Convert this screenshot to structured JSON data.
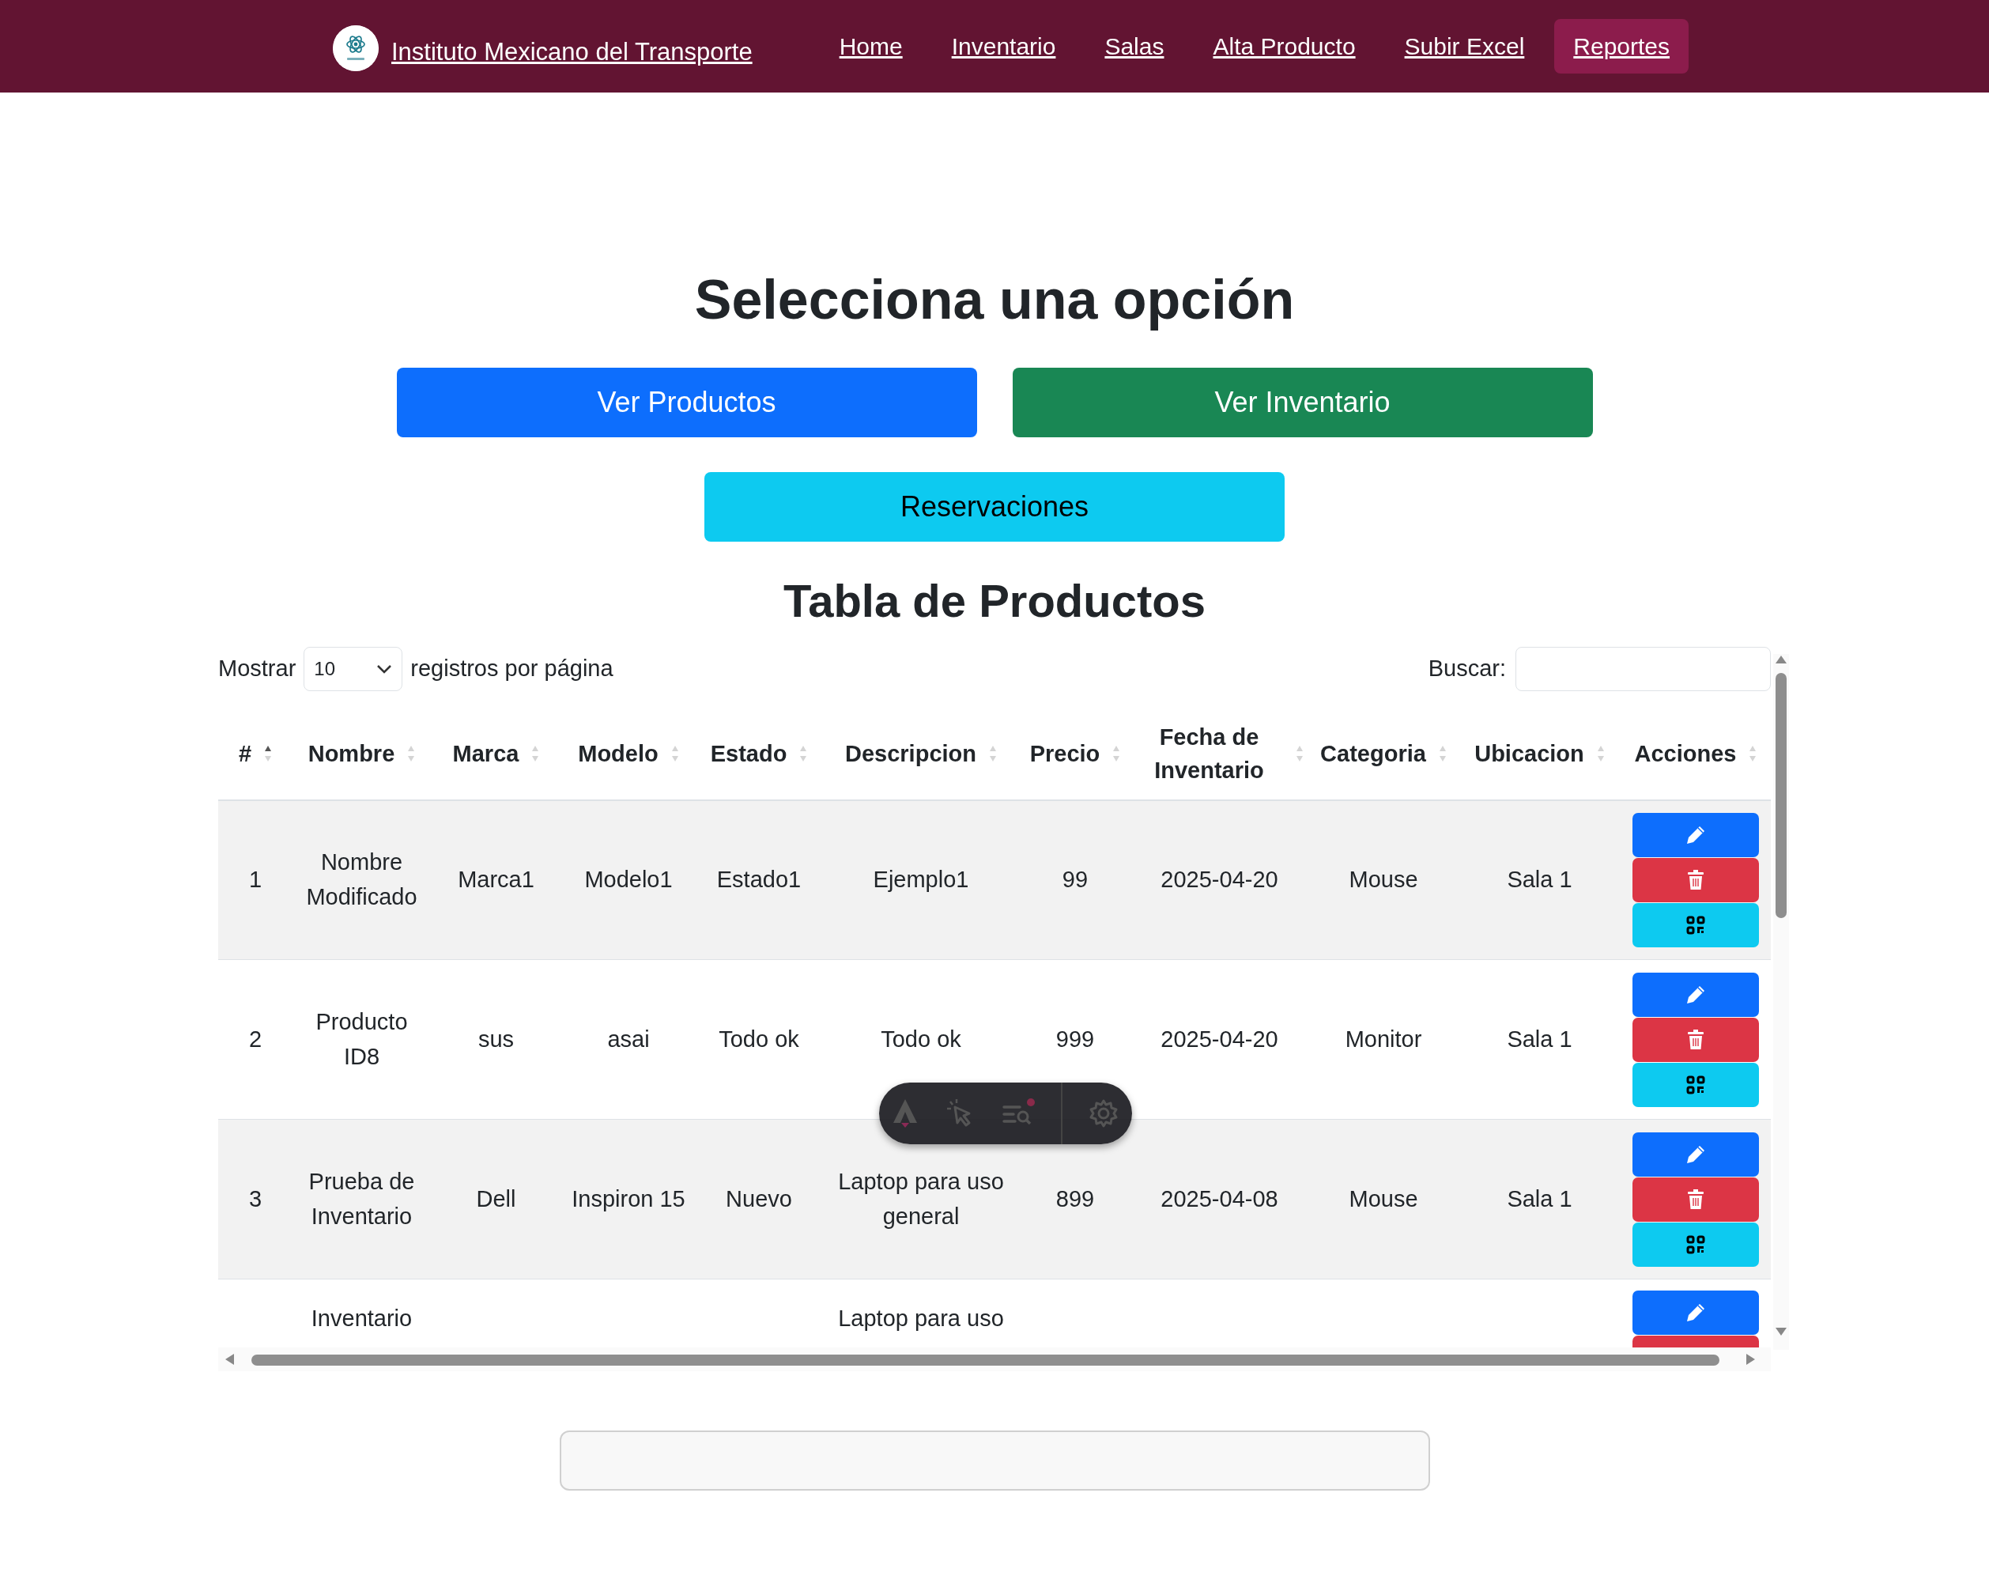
{
  "navbar": {
    "brand": "Instituto Mexicano del Transporte",
    "links": [
      {
        "label": "Home",
        "selected": false
      },
      {
        "label": "Inventario",
        "selected": false
      },
      {
        "label": "Salas",
        "selected": false
      },
      {
        "label": "Alta Producto",
        "selected": false
      },
      {
        "label": "Subir Excel",
        "selected": false
      },
      {
        "label": "Reportes",
        "selected": true
      }
    ]
  },
  "heading": "Selecciona una opción",
  "option_buttons": [
    {
      "label": "Ver Productos",
      "kind": "primary"
    },
    {
      "label": "Ver Inventario",
      "kind": "success"
    },
    {
      "label": "Reservaciones",
      "kind": "info"
    }
  ],
  "table_title": "Tabla de Productos",
  "length_control": {
    "prefix": "Mostrar",
    "value": "10",
    "suffix": "registros por página"
  },
  "search": {
    "label": "Buscar:"
  },
  "table": {
    "columns": [
      {
        "label": "#",
        "sorted": true
      },
      {
        "label": "Nombre",
        "sorted": false
      },
      {
        "label": "Marca",
        "sorted": false
      },
      {
        "label": "Modelo",
        "sorted": false
      },
      {
        "label": "Estado",
        "sorted": false
      },
      {
        "label": "Descripcion",
        "sorted": false
      },
      {
        "label": "Precio",
        "sorted": false
      },
      {
        "label": "Fecha de Inventario",
        "sorted": false
      },
      {
        "label": "Categoria",
        "sorted": false
      },
      {
        "label": "Ubicacion",
        "sorted": false
      },
      {
        "label": "Acciones",
        "sorted": false
      }
    ],
    "rows": [
      [
        "1",
        "Nombre Modificado",
        "Marca1",
        "Modelo1",
        "Estado1",
        "Ejemplo1",
        "99",
        "2025-04-20",
        "Mouse",
        "Sala 1"
      ],
      [
        "2",
        "Producto ID8",
        "sus",
        "asai",
        "Todo ok",
        "Todo ok",
        "999",
        "2025-04-20",
        "Monitor",
        "Sala 1"
      ],
      [
        "3",
        "Prueba de Inventario",
        "Dell",
        "Inspiron 15",
        "Nuevo",
        "Laptop para uso general",
        "899",
        "2025-04-08",
        "Mouse",
        "Sala 1"
      ],
      [
        "",
        "Inventario",
        "",
        "",
        "",
        "Laptop para uso",
        "",
        "",
        "",
        ""
      ]
    ]
  }
}
